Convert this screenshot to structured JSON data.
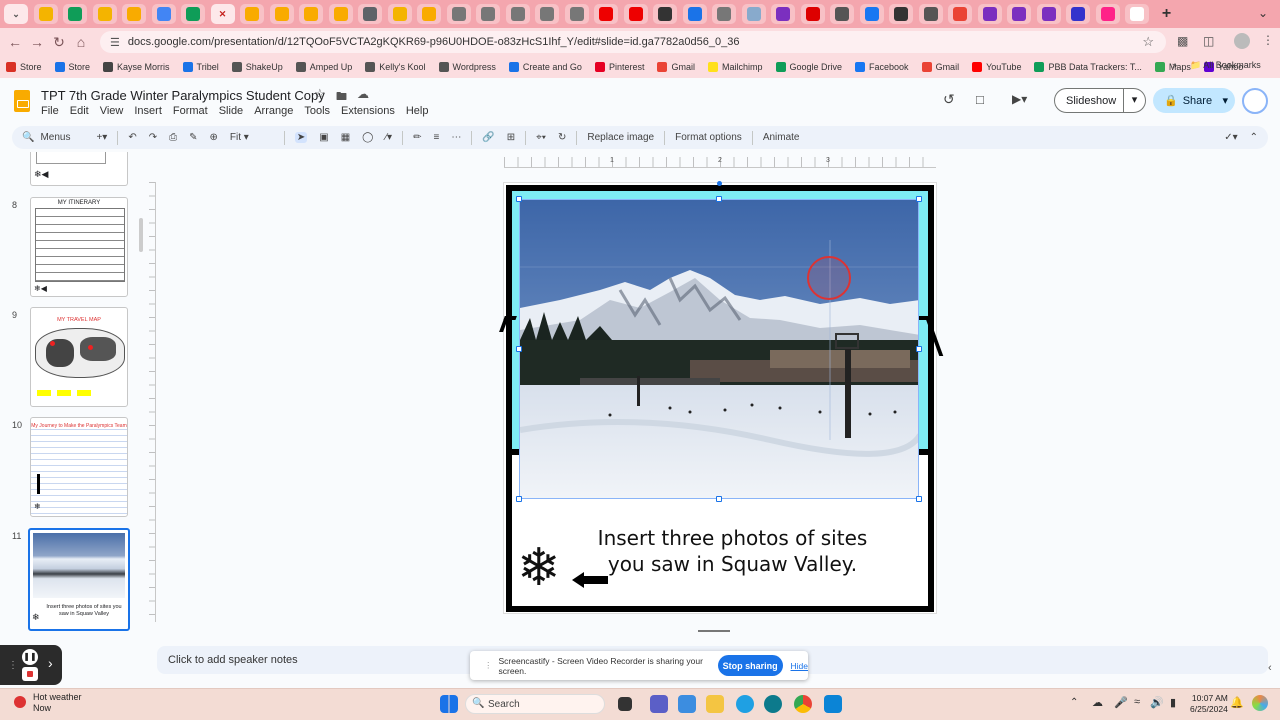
{
  "browser": {
    "url": "docs.google.com/presentation/d/12TQOoF5VCTA2gKQKR69-p96U0HDOE-o83zHcS1Ihf_Y/edit#slide=id.ga7782a0d56_0_36",
    "tab_count": 38
  },
  "bookmarks": [
    {
      "label": "Store",
      "color": "#d93025"
    },
    {
      "label": "Store",
      "color": "#1a73e8"
    },
    {
      "label": "Kayse Morris",
      "color": "#444444"
    },
    {
      "label": "Tribel",
      "color": "#1a73e8"
    },
    {
      "label": "ShakeUp",
      "color": "#555555"
    },
    {
      "label": "Amped Up",
      "color": "#555555"
    },
    {
      "label": "Kelly's Kool",
      "color": "#555555"
    },
    {
      "label": "Wordpress",
      "color": "#555555"
    },
    {
      "label": "Create and Go",
      "color": "#1a73e8"
    },
    {
      "label": "Pinterest",
      "color": "#e60023"
    },
    {
      "label": "Gmail",
      "color": "#ea4335"
    },
    {
      "label": "Mailchimp",
      "color": "#ffe01b"
    },
    {
      "label": "Google Drive",
      "color": "#0f9d58"
    },
    {
      "label": "Facebook",
      "color": "#1877f2"
    },
    {
      "label": "Gmail",
      "color": "#ea4335"
    },
    {
      "label": "YouTube",
      "color": "#ff0000"
    },
    {
      "label": "PBB Data Trackers: T...",
      "color": "#0f9d58"
    },
    {
      "label": "Maps",
      "color": "#34a853"
    },
    {
      "label": "Yahoo",
      "color": "#6001d2"
    }
  ],
  "all_bookmarks_label": "All Bookmarks",
  "doc": {
    "title": "TPT 7th Grade Winter Paralympics  Student Copy",
    "menus": [
      "File",
      "Edit",
      "View",
      "Insert",
      "Format",
      "Slide",
      "Arrange",
      "Tools",
      "Extensions",
      "Help"
    ],
    "slideshow_label": "Slideshow",
    "share_label": "Share"
  },
  "toolbar": {
    "menus_label": "Menus",
    "zoom": "Fit",
    "replace_image": "Replace image",
    "format_options": "Format options",
    "animate": "Animate"
  },
  "ruler_ticks": [
    "1",
    "2",
    "3"
  ],
  "filmstrip": [
    {
      "num": "8",
      "title": "MY ITINERARY"
    },
    {
      "num": "9",
      "title": "MY TRAVEL MAP"
    },
    {
      "num": "10",
      "title": "My Journey to Make the Paralympics Team"
    },
    {
      "num": "11",
      "title": "Insert three photos of sites you saw in Squaw Valley"
    }
  ],
  "slide": {
    "caption_line1": "Insert three photos of sites",
    "caption_line2": "you saw in Squaw Valley."
  },
  "notes_placeholder": "Click to add speaker notes",
  "screencastify": {
    "message": "Screencastify - Screen Video Recorder is sharing your screen.",
    "stop_label": "Stop sharing",
    "hide_label": "Hide"
  },
  "taskbar": {
    "weather_title": "Hot weather",
    "weather_sub": "Now",
    "search_placeholder": "Search",
    "time": "10:07 AM",
    "date": "6/25/2024"
  }
}
